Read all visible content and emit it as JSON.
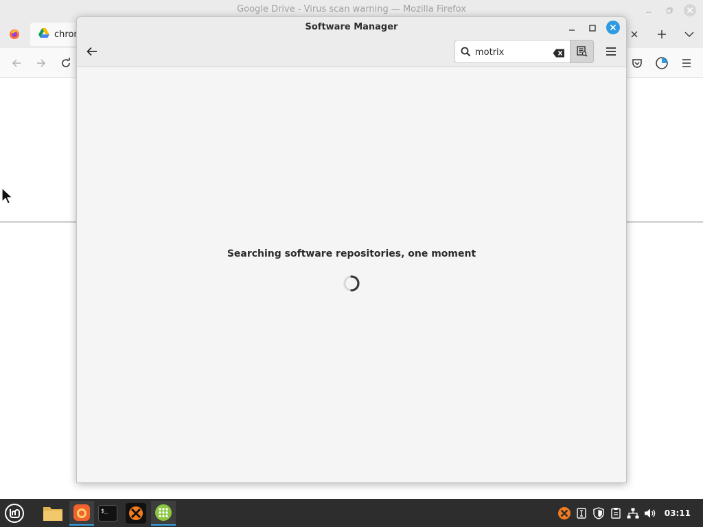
{
  "firefox": {
    "window_title": "Google Drive - Virus scan warning — Mozilla Firefox",
    "tab": {
      "label": "chrom",
      "icon": "google-drive-icon"
    },
    "tabbar_buttons": [
      "close-tab-icon",
      "new-tab-icon",
      "list-tabs-icon"
    ],
    "nav_buttons": [
      "back-icon",
      "forward-icon",
      "reload-icon"
    ],
    "toolbar_right": [
      "pocket-icon",
      "account-icon",
      "hamburger-menu-icon"
    ]
  },
  "software_manager": {
    "title": "Software Manager",
    "search": {
      "value": "motrix",
      "placeholder": ""
    },
    "status_text": "Searching software repositories, one moment",
    "icons": {
      "back": "back-arrow-icon",
      "search": "search-icon",
      "clear": "clear-search-icon",
      "search_mode": "search-in-summary-icon",
      "menu": "hamburger-menu-icon"
    },
    "accent": "#2f9be0"
  },
  "taskbar": {
    "clock": "03:11",
    "apps": [
      {
        "name": "files",
        "icon": "folder-icon",
        "active": false
      },
      {
        "name": "firefox",
        "icon": "firefox-icon",
        "active": true
      },
      {
        "name": "terminal",
        "icon": "terminal-icon",
        "active": false
      },
      {
        "name": "xampp",
        "icon": "xampp-icon",
        "active": false
      },
      {
        "name": "software-manager",
        "icon": "software-manager-icon",
        "active": true
      }
    ],
    "tray": [
      "xampp-tray-icon",
      "keyboard-layout-icon",
      "update-shield-icon",
      "clipboard-icon",
      "network-icon",
      "volume-icon"
    ]
  }
}
